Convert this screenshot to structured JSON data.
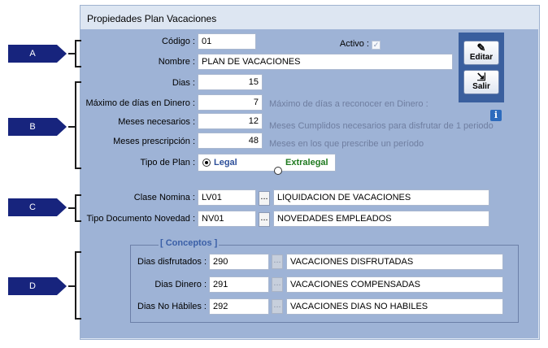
{
  "window": {
    "title": "Propiedades Plan Vacaciones"
  },
  "tags": {
    "a": "A",
    "b": "B",
    "c": "C",
    "d": "D"
  },
  "header": {
    "codigo_label": "Código :",
    "codigo_value": "01",
    "activo_label": "Activo :",
    "nombre_label": "Nombre :",
    "nombre_value": "PLAN DE VACACIONES"
  },
  "actions": {
    "editar_label": "Editar",
    "salir_label": "Salir"
  },
  "params": {
    "dias_label": "Dias :",
    "dias_value": "15",
    "maximo_label": "Máximo  de días en Dinero :",
    "maximo_value": "7",
    "maximo_hint": "Máximo  de días a reconocer en Dinero :",
    "meses_label": "Meses necesarios :",
    "meses_value": "12",
    "meses_hint": "Meses Cumplidos necesarios para disfrutar de 1 periodo",
    "prescripcion_label": "Meses prescripción :",
    "prescripcion_value": "48",
    "prescripcion_hint": "Meses en los que prescribe un período",
    "tipo_label": "Tipo de Plan :",
    "tipo_options": [
      "Legal",
      "Extralegal"
    ],
    "tipo_selected": "Legal"
  },
  "nomina": {
    "clase_label": "Clase Nomina :",
    "clase_code": "LV01",
    "clase_desc": "LIQUIDACION DE VACACIONES",
    "tipo_doc_label": "Tipo Documento Novedad :",
    "tipo_doc_code": "NV01",
    "tipo_doc_desc": "NOVEDADES EMPLEADOS",
    "browse_label": "..."
  },
  "conceptos": {
    "legend": "[ Conceptos ]",
    "rows": [
      {
        "label": "Dias disfrutados :",
        "code": "290",
        "desc": "VACACIONES DISFRUTADAS"
      },
      {
        "label": "Dias  Dinero :",
        "code": "291",
        "desc": "VACACIONES COMPENSADAS"
      },
      {
        "label": "Dias No Hábiles :",
        "code": "292",
        "desc": "VACACIONES DIAS NO HABILES"
      }
    ],
    "browse_label": "..."
  },
  "colors": {
    "panel": "#9eb3d6",
    "tag": "#17247d",
    "legal": "#2d4f9a",
    "extralegal": "#1f7a1f",
    "button_bar": "#3a5f9e"
  }
}
